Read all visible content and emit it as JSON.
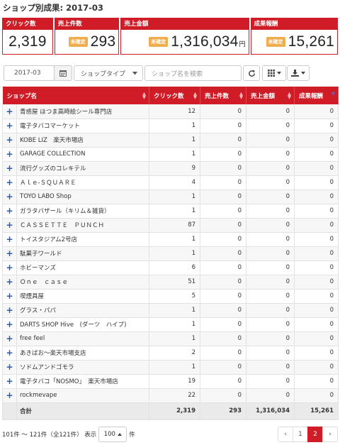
{
  "page_title": "ショップ別成果: 2017-03",
  "kpis": [
    {
      "label": "クリック数",
      "value": "2,319",
      "badge": "",
      "unit": ""
    },
    {
      "label": "売上件数",
      "value": "293",
      "badge": "未確定",
      "unit": ""
    },
    {
      "label": "売上金額",
      "value": "1,316,034",
      "badge": "未確定",
      "unit": "円"
    },
    {
      "label": "成果報酬",
      "value": "15,261",
      "badge": "未確定",
      "unit": ""
    }
  ],
  "toolbar": {
    "date_value": "2017-03",
    "calendar_icon": "calendar-icon",
    "shop_type_label": "ショップタイプ",
    "search_placeholder": "ショップ名を検索",
    "refresh_icon": "refresh-icon",
    "columns_icon": "grid-icon",
    "export_icon": "download-icon"
  },
  "table": {
    "columns": [
      "ショップ名",
      "クリック数",
      "売上件数",
      "売上金額",
      "成果報酬"
    ],
    "sorted_column": "成果報酬",
    "expand_glyph": "+",
    "rows": [
      {
        "name": "青惑屋 ほつま高時絵シール専門店",
        "clicks": "12",
        "sales": "0",
        "amount": "0",
        "reward": "0"
      },
      {
        "name": "電子タバコマーケット",
        "clicks": "1",
        "sales": "0",
        "amount": "0",
        "reward": "0"
      },
      {
        "name": "KOBE LIZ　楽天市場店",
        "clicks": "1",
        "sales": "0",
        "amount": "0",
        "reward": "0"
      },
      {
        "name": "GARAGE COLLECTION",
        "clicks": "1",
        "sales": "0",
        "amount": "0",
        "reward": "0"
      },
      {
        "name": "流行グッズのコレキテル",
        "clicks": "9",
        "sales": "0",
        "amount": "0",
        "reward": "0"
      },
      {
        "name": "Ａｌｅ-ＳＱＵＡＲＥ",
        "clicks": "4",
        "sales": "0",
        "amount": "0",
        "reward": "0"
      },
      {
        "name": "TOYO LABO Shop",
        "clicks": "1",
        "sales": "0",
        "amount": "0",
        "reward": "0"
      },
      {
        "name": "ガラタバザール（キリム＆雑貨）",
        "clicks": "1",
        "sales": "0",
        "amount": "0",
        "reward": "0"
      },
      {
        "name": "ＣＡＳＳＥＴＴＥ　ＰＵＮＣＨ",
        "clicks": "87",
        "sales": "0",
        "amount": "0",
        "reward": "0"
      },
      {
        "name": "トイスタジアム2号店",
        "clicks": "1",
        "sales": "0",
        "amount": "0",
        "reward": "0"
      },
      {
        "name": "駄菓子ワールド",
        "clicks": "1",
        "sales": "0",
        "amount": "0",
        "reward": "0"
      },
      {
        "name": "ホビーマンズ",
        "clicks": "6",
        "sales": "0",
        "amount": "0",
        "reward": "0"
      },
      {
        "name": "Ｏｎｅ　ｃａｓｅ",
        "clicks": "51",
        "sales": "0",
        "amount": "0",
        "reward": "0"
      },
      {
        "name": "喫煙具屋",
        "clicks": "5",
        "sales": "0",
        "amount": "0",
        "reward": "0"
      },
      {
        "name": "グラス・パパ",
        "clicks": "1",
        "sales": "0",
        "amount": "0",
        "reward": "0"
      },
      {
        "name": "DARTS SHOP Hive　(ダーツ　ハイブ)",
        "clicks": "1",
        "sales": "0",
        "amount": "0",
        "reward": "0"
      },
      {
        "name": "free feel",
        "clicks": "1",
        "sales": "0",
        "amount": "0",
        "reward": "0"
      },
      {
        "name": "あきばお～楽天市場支店",
        "clicks": "2",
        "sales": "0",
        "amount": "0",
        "reward": "0"
      },
      {
        "name": "ソドムアンドゴモラ",
        "clicks": "1",
        "sales": "0",
        "amount": "0",
        "reward": "0"
      },
      {
        "name": "電子タバコ「NOSMO」　楽天市場店",
        "clicks": "19",
        "sales": "0",
        "amount": "0",
        "reward": "0"
      },
      {
        "name": "rockmevape",
        "clicks": "22",
        "sales": "0",
        "amount": "0",
        "reward": "0"
      }
    ],
    "total": {
      "label": "合計",
      "clicks": "2,319",
      "sales": "293",
      "amount": "1,316,034",
      "reward": "15,261"
    }
  },
  "footer": {
    "range_text": "101件 ～ 121件（全121件） 表示",
    "page_size": "100",
    "page_size_suffix": "件"
  },
  "pagination": {
    "prev": "‹",
    "pages": [
      "1",
      "2"
    ],
    "current": "2",
    "next": "›"
  },
  "colors": {
    "accent": "#cf1c26",
    "badge": "#f0ad4e",
    "expand": "#2b5aa8"
  }
}
